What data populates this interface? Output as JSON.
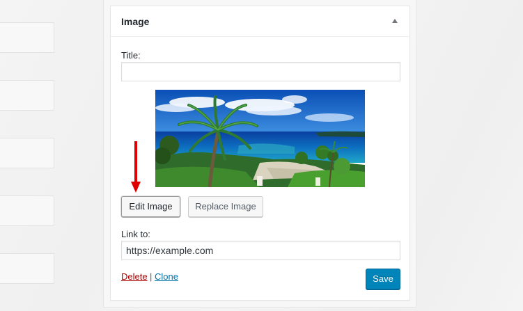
{
  "widget": {
    "title": "Image",
    "toggle_icon": "triangle-up-icon"
  },
  "title_field": {
    "label": "Title:",
    "value": ""
  },
  "image_preview": {
    "alt": "Beach with palm trees"
  },
  "buttons": {
    "edit_image": "Edit Image",
    "replace_image": "Replace Image",
    "save": "Save"
  },
  "link_field": {
    "label": "Link to:",
    "value": "https://example.com"
  },
  "actions": {
    "delete": "Delete",
    "separator": "|",
    "clone": "Clone"
  },
  "annotation": {
    "arrow_color": "#e00000"
  },
  "colors": {
    "primary": "#0085ba",
    "delete": "#aa0000",
    "link": "#0073aa"
  }
}
